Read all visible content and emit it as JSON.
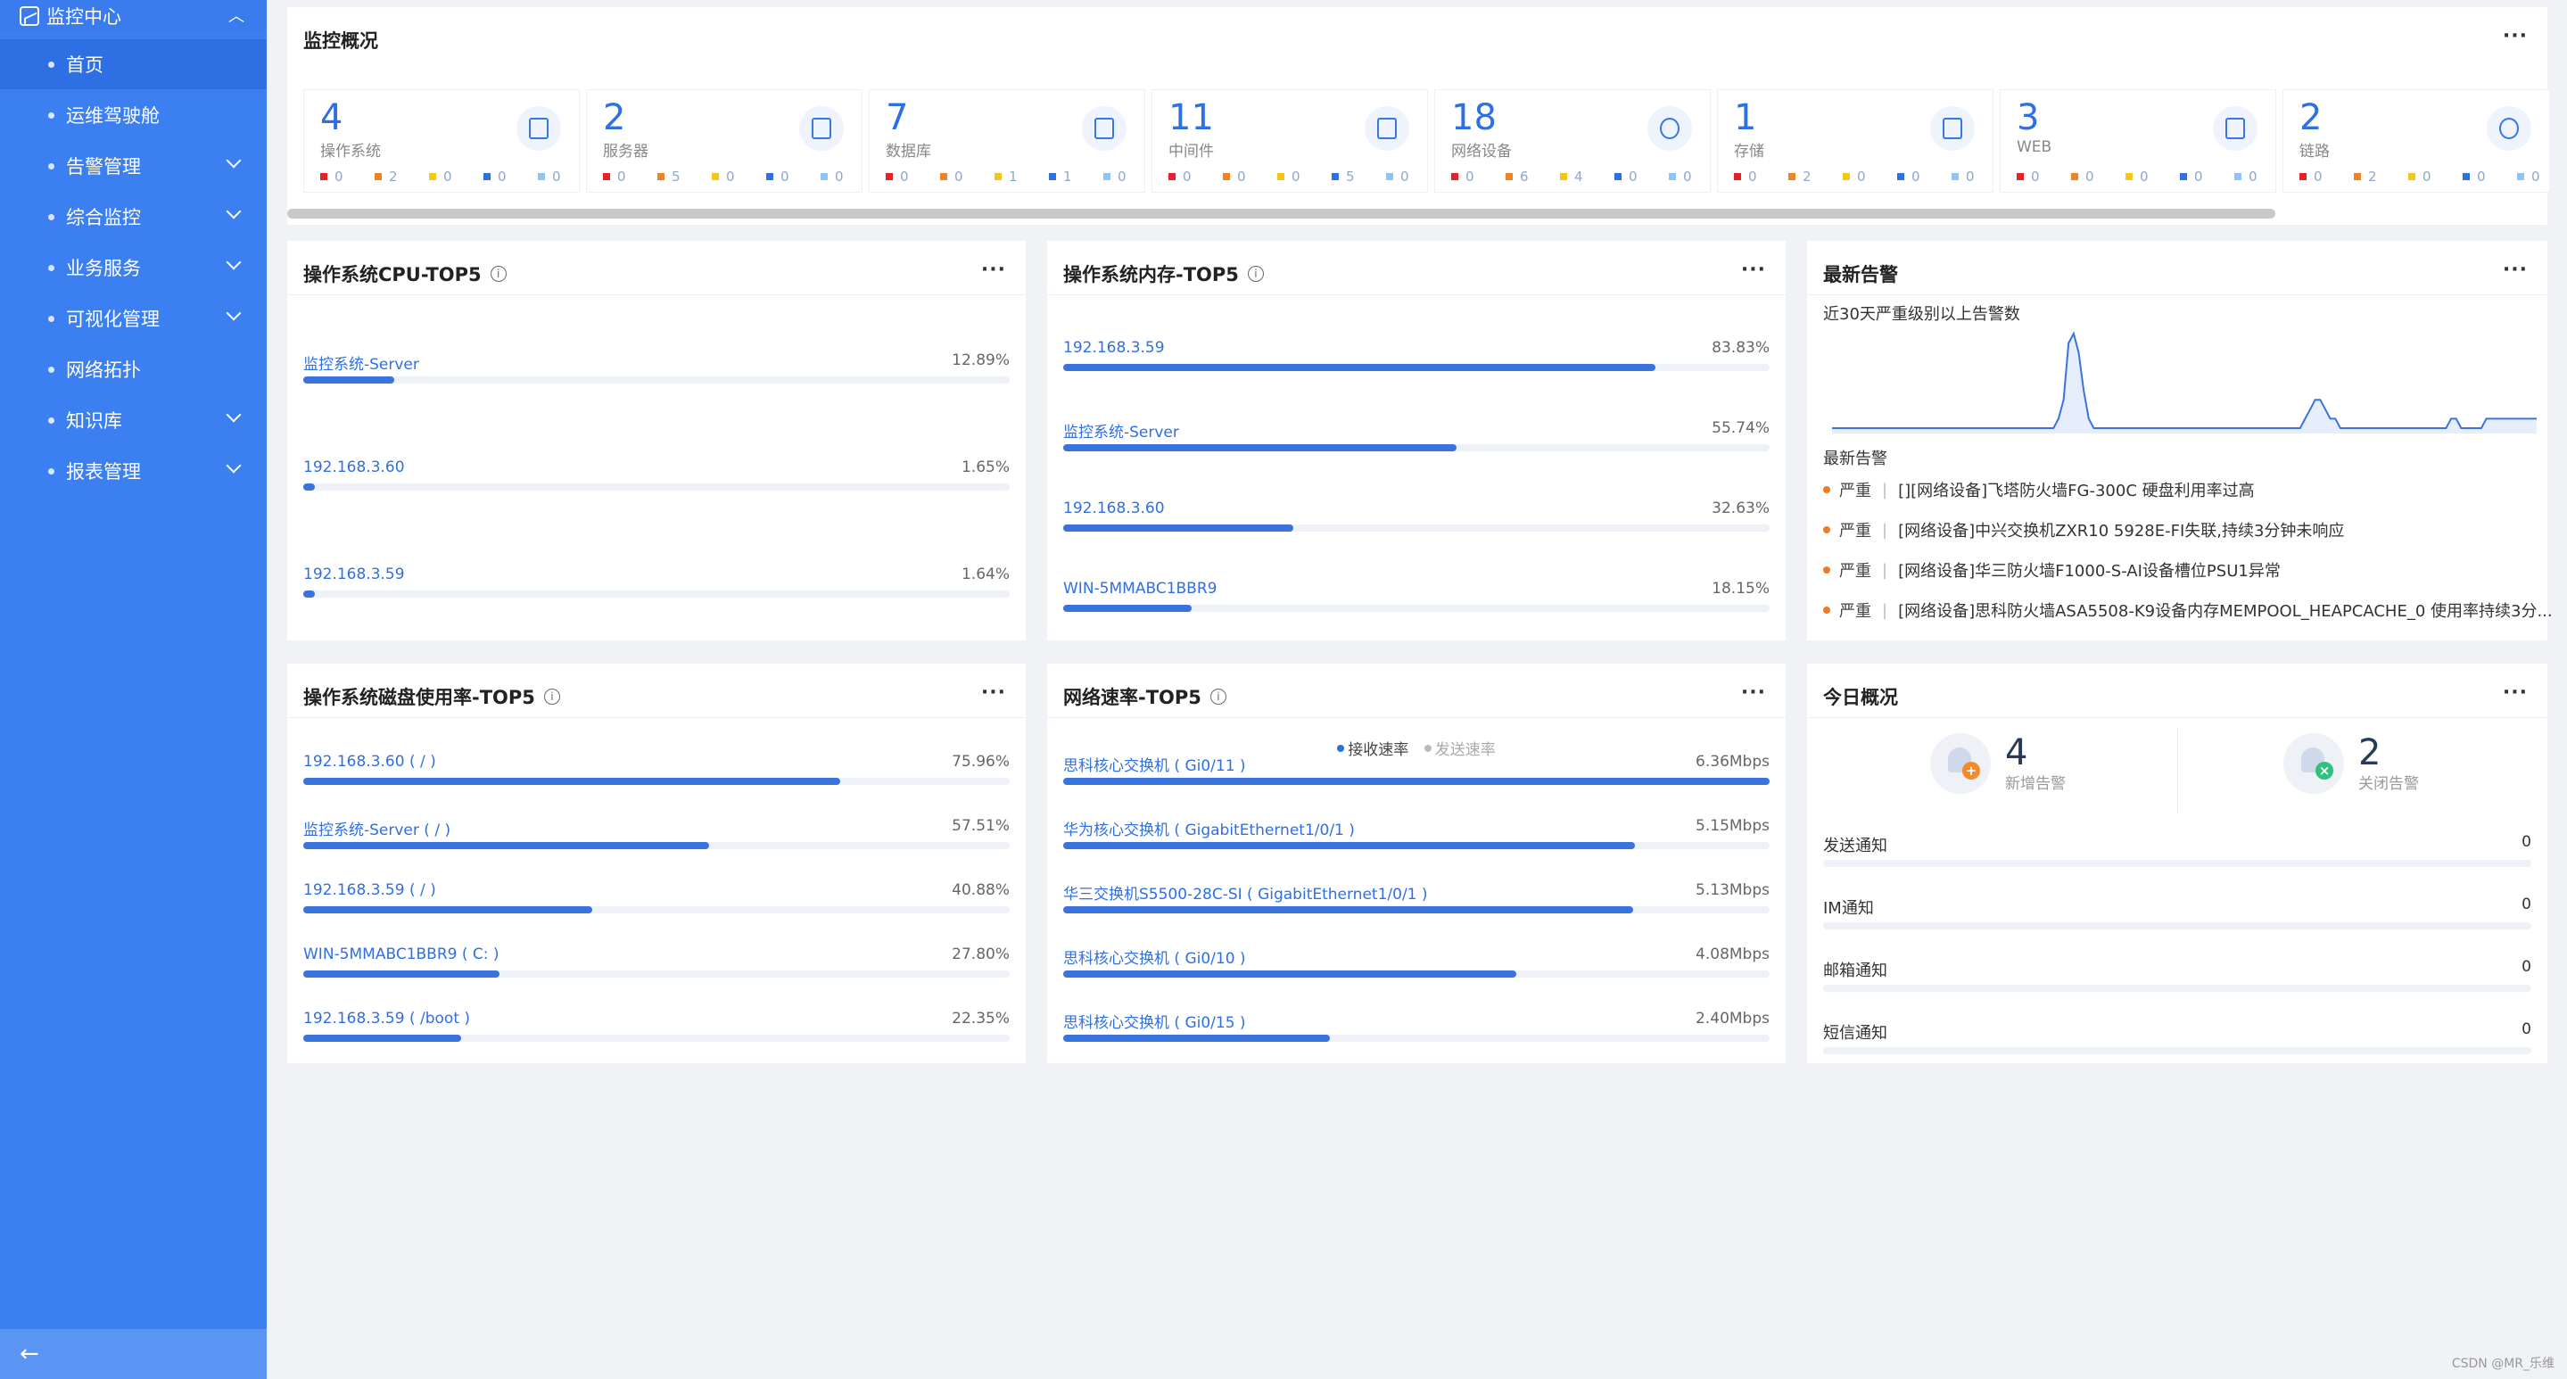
{
  "sidebar": {
    "header": "监控中心",
    "items": [
      {
        "label": "首页",
        "active": true,
        "has_children": false
      },
      {
        "label": "运维驾驶舱",
        "active": false,
        "has_children": false
      },
      {
        "label": "告警管理",
        "active": false,
        "has_children": true
      },
      {
        "label": "综合监控",
        "active": false,
        "has_children": true
      },
      {
        "label": "业务服务",
        "active": false,
        "has_children": true
      },
      {
        "label": "可视化管理",
        "active": false,
        "has_children": true
      },
      {
        "label": "网络拓扑",
        "active": false,
        "has_children": false
      },
      {
        "label": "知识库",
        "active": false,
        "has_children": true
      },
      {
        "label": "报表管理",
        "active": false,
        "has_children": true
      }
    ],
    "collapse_icon": "arrow-left-icon"
  },
  "overview": {
    "title": "监控概况",
    "more": "···",
    "status_colors": [
      "#e8202a",
      "#f58220",
      "#f5c518",
      "#2f6fe4",
      "#8ec5f5"
    ],
    "boxes": [
      {
        "count": "4",
        "label": "操作系统",
        "icon": "os-icon",
        "stats": [
          "0",
          "2",
          "0",
          "0",
          "0"
        ]
      },
      {
        "count": "2",
        "label": "服务器",
        "icon": "server-icon",
        "stats": [
          "0",
          "5",
          "0",
          "0",
          "0"
        ]
      },
      {
        "count": "7",
        "label": "数据库",
        "icon": "database-icon",
        "stats": [
          "0",
          "0",
          "1",
          "1",
          "0"
        ]
      },
      {
        "count": "11",
        "label": "中间件",
        "icon": "middleware-icon",
        "stats": [
          "0",
          "0",
          "0",
          "5",
          "0"
        ]
      },
      {
        "count": "18",
        "label": "网络设备",
        "icon": "globe-icon",
        "stats": [
          "0",
          "6",
          "4",
          "0",
          "0"
        ]
      },
      {
        "count": "1",
        "label": "存储",
        "icon": "storage-icon",
        "stats": [
          "0",
          "2",
          "0",
          "0",
          "0"
        ]
      },
      {
        "count": "3",
        "label": "WEB",
        "icon": "monitor-icon",
        "stats": [
          "0",
          "0",
          "0",
          "0",
          "0"
        ]
      },
      {
        "count": "2",
        "label": "链路",
        "icon": "link-icon",
        "stats": [
          "0",
          "2",
          "0",
          "0",
          "0"
        ]
      }
    ]
  },
  "cpu": {
    "title": "操作系统CPU-TOP5",
    "more": "···",
    "rows": [
      {
        "name": "监控系统-Server",
        "value": "12.89%",
        "pct": 12.89
      },
      {
        "name": "192.168.3.60",
        "value": "1.65%",
        "pct": 1.65
      },
      {
        "name": "192.168.3.59",
        "value": "1.64%",
        "pct": 1.64
      }
    ]
  },
  "memory": {
    "title": "操作系统内存-TOP5",
    "more": "···",
    "rows": [
      {
        "name": "192.168.3.59",
        "value": "83.83%",
        "pct": 83.83
      },
      {
        "name": "监控系统-Server",
        "value": "55.74%",
        "pct": 55.74
      },
      {
        "name": "192.168.3.60",
        "value": "32.63%",
        "pct": 32.63
      },
      {
        "name": "WIN-5MMABC1BBR9",
        "value": "18.15%",
        "pct": 18.15
      }
    ]
  },
  "alerts": {
    "title": "最新告警",
    "more": "···",
    "chart_label": "近30天严重级别以上告警数",
    "list_label": "最新告警",
    "items": [
      {
        "level": "严重",
        "text": "[][网络设备]飞塔防火墙FG-300C 硬盘利用率过高"
      },
      {
        "level": "严重",
        "text": "[网络设备]中兴交换机ZXR10 5928E-FI失联,持续3分钟未响应"
      },
      {
        "level": "严重",
        "text": "[网络设备]华三防火墙F1000-S-AI设备槽位PSU1异常"
      },
      {
        "level": "严重",
        "text": "[网络设备]思科防火墙ASA5508-K9设备内存MEMPOOL_HEAPCACHE_0 使用率持续3分..."
      }
    ]
  },
  "chart_data": {
    "type": "area",
    "title": "近30天严重级别以上告警数",
    "xlabel": "",
    "ylabel": "",
    "grid": false,
    "values": [
      0,
      0,
      0,
      0,
      0,
      0,
      0,
      0,
      0,
      0,
      0,
      0,
      0,
      0,
      0,
      0,
      0,
      0,
      0,
      0,
      0,
      0,
      0,
      0,
      0,
      0,
      0,
      0,
      0,
      0,
      0,
      0,
      0,
      0,
      0,
      0,
      0,
      0,
      0,
      0,
      0,
      0,
      0,
      0,
      0,
      1,
      3,
      9,
      10,
      8,
      4,
      1,
      0,
      0,
      0,
      0,
      0,
      0,
      0,
      0,
      0,
      0,
      0,
      0,
      0,
      0,
      0,
      0,
      0,
      0,
      0,
      0,
      0,
      0,
      0,
      0,
      0,
      0,
      0,
      0,
      0,
      0,
      0,
      0,
      0,
      0,
      0,
      0,
      0,
      0,
      0,
      0,
      0,
      0,
      1,
      2,
      3,
      3,
      2,
      1,
      1,
      0,
      0,
      0,
      0,
      0,
      0,
      0,
      0,
      0,
      0,
      0,
      0,
      0,
      0,
      0,
      0,
      0,
      0,
      0,
      0,
      0,
      0,
      1,
      1,
      0,
      0,
      0,
      0,
      0,
      1,
      1,
      1,
      1,
      1,
      1,
      1,
      1,
      1,
      1,
      1
    ]
  },
  "disk": {
    "title": "操作系统磁盘使用率-TOP5",
    "more": "···",
    "rows": [
      {
        "name": "192.168.3.60 ( / )",
        "value": "75.96%",
        "pct": 75.96
      },
      {
        "name": "监控系统-Server ( / )",
        "value": "57.51%",
        "pct": 57.51
      },
      {
        "name": "192.168.3.59 ( / )",
        "value": "40.88%",
        "pct": 40.88
      },
      {
        "name": "WIN-5MMABC1BBR9 ( C: )",
        "value": "27.80%",
        "pct": 27.8
      },
      {
        "name": "192.168.3.59 ( /boot )",
        "value": "22.35%",
        "pct": 22.35
      }
    ]
  },
  "network": {
    "title": "网络速率-TOP5",
    "more": "···",
    "legend": [
      {
        "label": "接收速率",
        "color": "#2f6fe4",
        "active": true
      },
      {
        "label": "发送速率",
        "color": "#bbbbbb",
        "active": false
      }
    ],
    "rows": [
      {
        "name": "思科核心交换机 ( Gi0/11 )",
        "value": "6.36Mbps",
        "pct": 100
      },
      {
        "name": "华为核心交换机 ( GigabitEthernet1/0/1 )",
        "value": "5.15Mbps",
        "pct": 80.97
      },
      {
        "name": "华三交换机S5500-28C-SI ( GigabitEthernet1/0/1 )",
        "value": "5.13Mbps",
        "pct": 80.66
      },
      {
        "name": "思科核心交换机 ( Gi0/10 )",
        "value": "4.08Mbps",
        "pct": 64.15
      },
      {
        "name": "思科核心交换机 ( Gi0/15 )",
        "value": "2.40Mbps",
        "pct": 37.74
      }
    ]
  },
  "today": {
    "title": "今日概况",
    "more": "···",
    "new_alerts": {
      "count": "4",
      "label": "新增告警"
    },
    "closed_alerts": {
      "count": "2",
      "label": "关闭告警"
    },
    "notifications": [
      {
        "label": "发送通知",
        "value": "0"
      },
      {
        "label": "IM通知",
        "value": "0"
      },
      {
        "label": "邮箱通知",
        "value": "0"
      },
      {
        "label": "短信通知",
        "value": "0"
      }
    ]
  },
  "watermark": "CSDN @MR_乐维"
}
